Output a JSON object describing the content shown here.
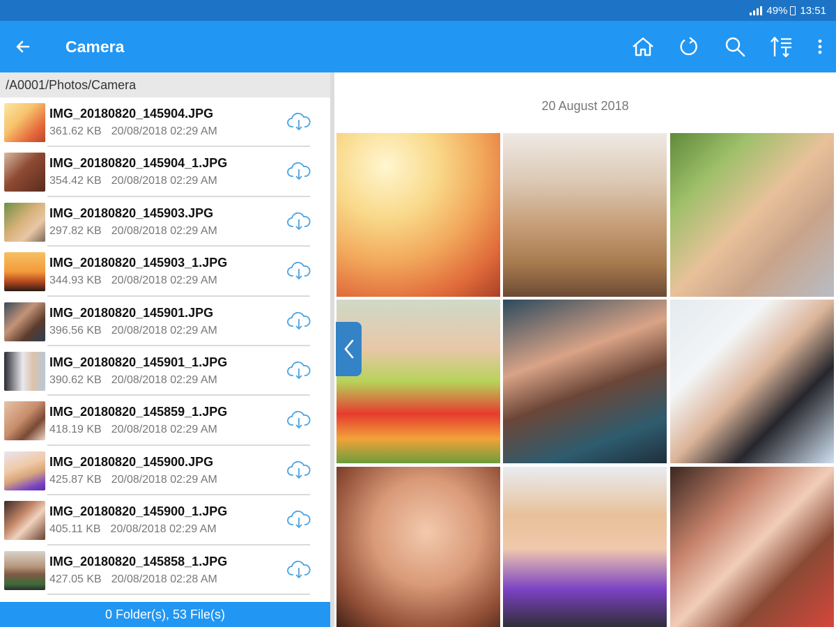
{
  "status_bar": {
    "battery": "49%",
    "time": "13:51"
  },
  "app_bar": {
    "title": "Camera",
    "back_icon": "arrow-left-icon",
    "actions": [
      "home-icon",
      "refresh-icon",
      "search-icon",
      "sort-icon",
      "more-vert-icon"
    ]
  },
  "path": "/A0001/Photos/Camera",
  "files": [
    {
      "name": "IMG_20180820_145904.JPG",
      "size": "361.62 KB",
      "date": "20/08/2018 02:29 AM"
    },
    {
      "name": "IMG_20180820_145904_1.JPG",
      "size": "354.42 KB",
      "date": "20/08/2018 02:29 AM"
    },
    {
      "name": "IMG_20180820_145903.JPG",
      "size": "297.82 KB",
      "date": "20/08/2018 02:29 AM"
    },
    {
      "name": "IMG_20180820_145903_1.JPG",
      "size": "344.93 KB",
      "date": "20/08/2018 02:29 AM"
    },
    {
      "name": "IMG_20180820_145901.JPG",
      "size": "396.56 KB",
      "date": "20/08/2018 02:29 AM"
    },
    {
      "name": "IMG_20180820_145901_1.JPG",
      "size": "390.62 KB",
      "date": "20/08/2018 02:29 AM"
    },
    {
      "name": "IMG_20180820_145859_1.JPG",
      "size": "418.19 KB",
      "date": "20/08/2018 02:29 AM"
    },
    {
      "name": "IMG_20180820_145900.JPG",
      "size": "425.87 KB",
      "date": "20/08/2018 02:29 AM"
    },
    {
      "name": "IMG_20180820_145900_1.JPG",
      "size": "405.11 KB",
      "date": "20/08/2018 02:29 AM"
    },
    {
      "name": "IMG_20180820_145858_1.JPG",
      "size": "427.05 KB",
      "date": "20/08/2018 02:28 AM"
    }
  ],
  "footer": "0 Folder(s), 53 File(s)",
  "gallery": {
    "date_header": "20 August 2018"
  },
  "colors": {
    "status_bar": "#1d74c6",
    "app_bar": "#2196f3",
    "cloud_icon": "#4aa3df",
    "footer": "#2196f3"
  }
}
